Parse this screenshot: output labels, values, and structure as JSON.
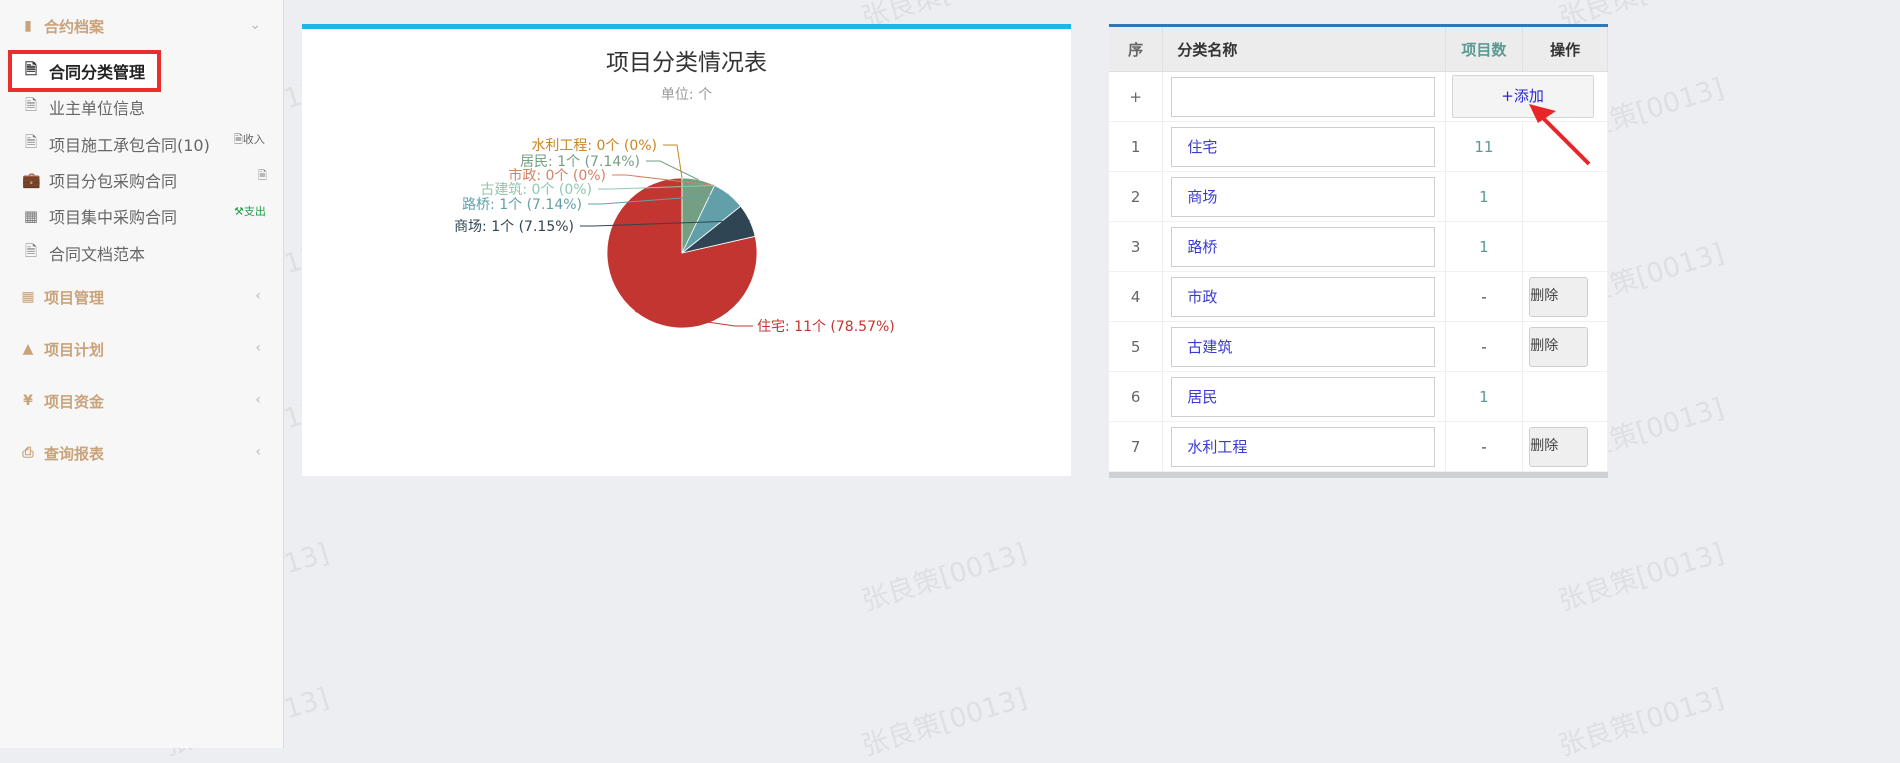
{
  "sidebar": {
    "groups": [
      {
        "label": "合约档案",
        "icon": "book-icon",
        "expanded": true
      },
      {
        "label": "项目管理",
        "icon": "calendar-icon"
      },
      {
        "label": "项目计划",
        "icon": "area-chart-icon"
      },
      {
        "label": "项目资金",
        "icon": "yen-icon"
      },
      {
        "label": "查询报表",
        "icon": "printer-icon"
      }
    ],
    "items": [
      {
        "label": "合同分类管理",
        "icon": "document-icon",
        "active": true
      },
      {
        "label": "业主单位信息",
        "icon": "document-icon"
      },
      {
        "label": "项目施工承包合同(10)",
        "icon": "document-icon",
        "tag": "收入",
        "tag_icon": "document-icon"
      },
      {
        "label": "项目分包采购合同",
        "icon": "briefcase-icon",
        "tag_icon": "document-icon"
      },
      {
        "label": "项目集中采购合同",
        "icon": "calculator-icon",
        "tag": "支出",
        "tag_icon": "tool-icon"
      },
      {
        "label": "合同文档范本",
        "icon": "word-document-icon"
      }
    ]
  },
  "chart_panel": {
    "title": "项目分类情况表",
    "subtitle": "单位: 个"
  },
  "chart_data": {
    "type": "pie",
    "title": "项目分类情况表",
    "subtitle": "单位: 个",
    "slices": [
      {
        "name": "住宅",
        "value": 11,
        "label": "住宅: 11个 (78.57%)",
        "color": "#c23531"
      },
      {
        "name": "商场",
        "value": 1,
        "label": "商场: 1个 (7.15%)",
        "color": "#2f4554"
      },
      {
        "name": "路桥",
        "value": 1,
        "label": "路桥: 1个 (7.14%)",
        "color": "#61a0a8"
      },
      {
        "name": "古建筑",
        "value": 0,
        "label": "古建筑: 0个 (0%)",
        "color": "#91c7ae"
      },
      {
        "name": "市政",
        "value": 0,
        "label": "市政: 0个 (0%)",
        "color": "#d48265"
      },
      {
        "name": "居民",
        "value": 1,
        "label": "居民: 1个 (7.14%)",
        "color": "#749f83"
      },
      {
        "name": "水利工程",
        "value": 0,
        "label": "水利工程: 0个 (0%)",
        "color": "#ca8622"
      }
    ]
  },
  "table": {
    "headers": {
      "seq": "序",
      "name": "分类名称",
      "count": "项目数",
      "op": "操作"
    },
    "new_row": {
      "seq": "+",
      "input_value": "",
      "add_label": "+添加"
    },
    "rows": [
      {
        "seq": "1",
        "name": "住宅",
        "count": "11",
        "action": ""
      },
      {
        "seq": "2",
        "name": "商场",
        "count": "1",
        "action": ""
      },
      {
        "seq": "3",
        "name": "路桥",
        "count": "1",
        "action": ""
      },
      {
        "seq": "4",
        "name": "市政",
        "count": "-",
        "action": "删除"
      },
      {
        "seq": "5",
        "name": "古建筑",
        "count": "-",
        "action": "删除"
      },
      {
        "seq": "6",
        "name": "居民",
        "count": "1",
        "action": ""
      },
      {
        "seq": "7",
        "name": "水利工程",
        "count": "-",
        "action": "删除"
      }
    ]
  },
  "watermark": {
    "text": "张良策[0013]"
  },
  "colors": {
    "highlight_border": "#ea2e2e",
    "chart_panel_accent": "#1db7e6",
    "table_panel_accent": "#3077b8",
    "link_blue": "#3b3bd1",
    "group_label": "#caa37a",
    "arrow": "#e8262a"
  }
}
